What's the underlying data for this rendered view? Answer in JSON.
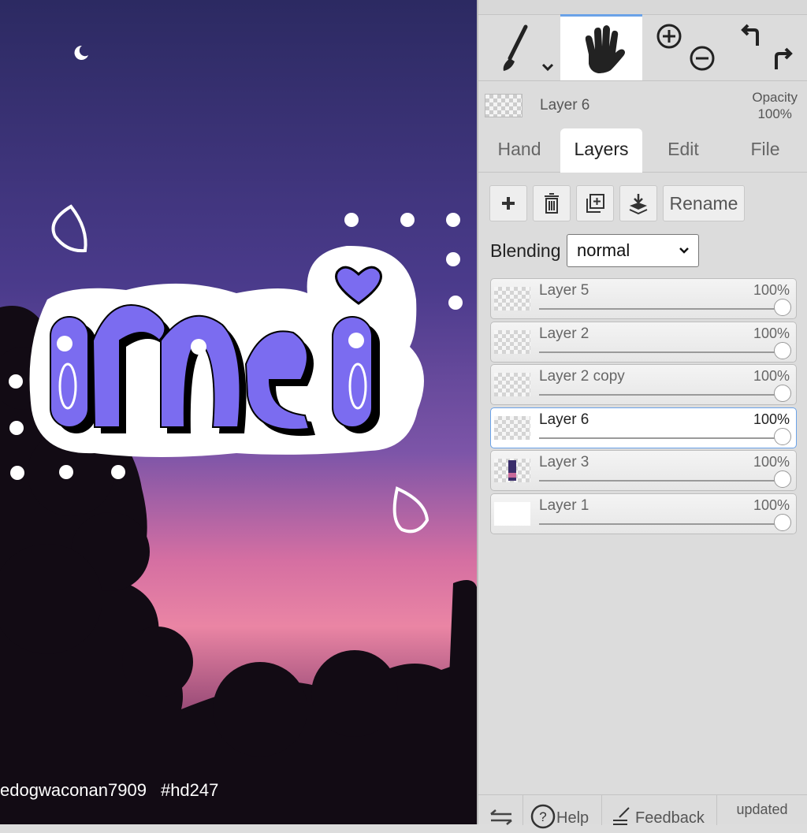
{
  "canvas": {
    "credit_user": "edogwaconan7909",
    "credit_tag": "#hd247",
    "artwork_text": "mei"
  },
  "tools": {
    "items": [
      {
        "name": "brush",
        "icon": "brush-icon"
      },
      {
        "name": "hand",
        "icon": "hand-icon",
        "active": true
      },
      {
        "name": "zoom",
        "icon": "zoom-in-out-icon"
      },
      {
        "name": "undo-redo",
        "icon": "undo-redo-icon"
      }
    ]
  },
  "current_layer": {
    "name": "Layer 6",
    "opacity_label": "Opacity",
    "opacity_value": "100%"
  },
  "tabs": [
    {
      "label": "Hand"
    },
    {
      "label": "Layers",
      "active": true
    },
    {
      "label": "Edit"
    },
    {
      "label": "File"
    }
  ],
  "actions": {
    "rename_label": "Rename"
  },
  "blending": {
    "label": "Blending",
    "value": "normal"
  },
  "layers": [
    {
      "name": "Layer 5",
      "opacity": "100%"
    },
    {
      "name": "Layer 2",
      "opacity": "100%"
    },
    {
      "name": "Layer 2 copy",
      "opacity": "100%"
    },
    {
      "name": "Layer 6",
      "opacity": "100%",
      "active": true
    },
    {
      "name": "Layer 3",
      "opacity": "100%"
    },
    {
      "name": "Layer 1",
      "opacity": "100%"
    }
  ],
  "footer": {
    "help": "Help",
    "feedback": "Feedback",
    "updated": "updated"
  },
  "colors": {
    "accent": "#6aa2e8",
    "letter_fill": "#7b6cf0",
    "sky_top": "#2f2a63",
    "sky_pink": "#e47aa8"
  }
}
